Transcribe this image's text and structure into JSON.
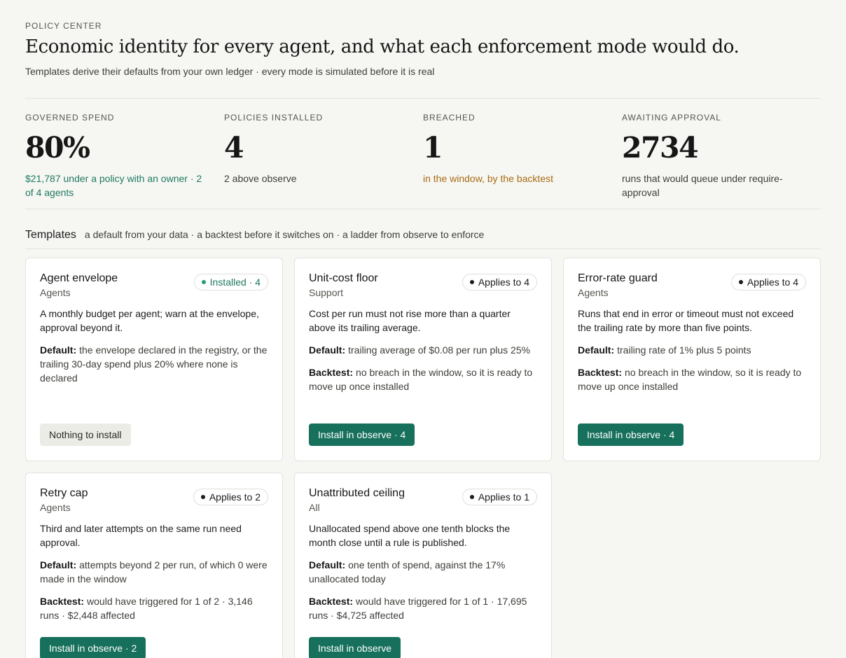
{
  "header": {
    "eyebrow": "POLICY CENTER",
    "title": "Economic identity for every agent, and what each enforcement mode would do.",
    "subtitle": "Templates derive their defaults from your own ledger · every mode is simulated before it is real"
  },
  "stats": [
    {
      "label": "GOVERNED SPEND",
      "value": "80%",
      "note": "$21,787 under a policy with an owner · 2 of 4 agents",
      "tone": "green"
    },
    {
      "label": "POLICIES INSTALLED",
      "value": "4",
      "note": "2 above observe",
      "tone": "neutral"
    },
    {
      "label": "BREACHED",
      "value": "1",
      "note": "in the window, by the backtest",
      "tone": "amber"
    },
    {
      "label": "AWAITING APPROVAL",
      "value": "2734",
      "note": "runs that would queue under require-approval",
      "tone": "neutral"
    }
  ],
  "templates": {
    "title": "Templates",
    "subtitle": "a default from your data · a backtest before it switches on · a ladder from observe to enforce",
    "default_key": "Default:",
    "backtest_key": "Backtest:",
    "cards": [
      {
        "name": "Agent envelope",
        "scope": "Agents",
        "badge": "Installed · 4",
        "badge_state": "installed",
        "desc": "A monthly budget per agent; warn at the envelope, approval beyond it.",
        "default": "the envelope declared in the registry, or the trailing 30-day spend plus 20% where none is declared",
        "backtest": "",
        "button": "Nothing to install",
        "button_style": "muted"
      },
      {
        "name": "Unit-cost floor",
        "scope": "Support",
        "badge": "Applies to 4",
        "badge_state": "applies",
        "desc": "Cost per run must not rise more than a quarter above its trailing average.",
        "default": "trailing average of $0.08 per run plus 25%",
        "backtest": "no breach in the window, so it is ready to move up once installed",
        "button": "Install in observe · 4",
        "button_style": "primary"
      },
      {
        "name": "Error-rate guard",
        "scope": "Agents",
        "badge": "Applies to 4",
        "badge_state": "applies",
        "desc": "Runs that end in error or timeout must not exceed the trailing rate by more than five points.",
        "default": "trailing rate of 1% plus 5 points",
        "backtest": "no breach in the window, so it is ready to move up once installed",
        "button": "Install in observe · 4",
        "button_style": "primary"
      },
      {
        "name": "Retry cap",
        "scope": "Agents",
        "badge": "Applies to 2",
        "badge_state": "applies",
        "desc": "Third and later attempts on the same run need approval.",
        "default": "attempts beyond 2 per run, of which 0 were made in the window",
        "backtest": "would have triggered for 1 of 2 · 3,146 runs · $2,448 affected",
        "button": "Install in observe · 2",
        "button_style": "primary"
      },
      {
        "name": "Unattributed ceiling",
        "scope": "All",
        "badge": "Applies to 1",
        "badge_state": "applies",
        "desc": "Unallocated spend above one tenth blocks the month close until a rule is published.",
        "default": "one tenth of spend, against the 17% unallocated today",
        "backtest": "would have triggered for 1 of 1 · 17,695 runs · $4,725 affected",
        "button": "Install in observe",
        "button_style": "primary"
      }
    ]
  }
}
